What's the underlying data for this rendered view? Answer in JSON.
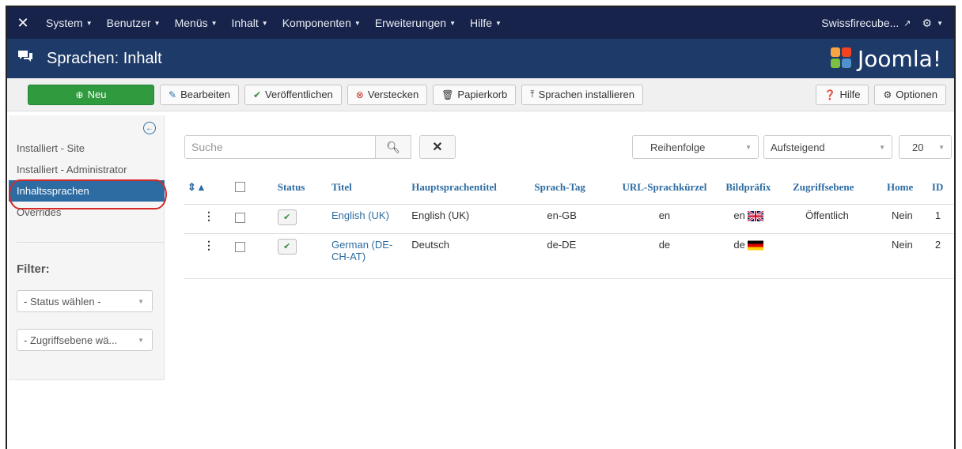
{
  "topbar": {
    "logo_icon": "joomla-x-icon",
    "menus": [
      "System",
      "Benutzer",
      "Menüs",
      "Inhalt",
      "Komponenten",
      "Erweiterungen",
      "Hilfe"
    ],
    "site_link": "Swissfirecube...",
    "settings_icon": "gear-icon"
  },
  "header": {
    "title": "Sprachen: Inhalt",
    "brand": "Joomla!"
  },
  "toolbar": {
    "new": "Neu",
    "edit": "Bearbeiten",
    "publish": "Veröffentlichen",
    "unpublish": "Verstecken",
    "trash": "Papierkorb",
    "install": "Sprachen installieren",
    "help": "Hilfe",
    "options": "Optionen"
  },
  "sidebar": {
    "items": [
      "Installiert - Site",
      "Installiert - Administrator",
      "Inhaltssprachen",
      "Overrides"
    ],
    "active_index": 2,
    "filter_label": "Filter:",
    "status_select": "- Status wählen -",
    "access_select": "- Zugriffsebene wä..."
  },
  "search": {
    "placeholder": "Suche",
    "ordering": "Reihenfolge",
    "direction": "Aufsteigend",
    "limit": "20"
  },
  "table": {
    "headers": {
      "status": "Status",
      "title": "Titel",
      "native": "Hauptsprachentitel",
      "tag": "Sprach-Tag",
      "sef": "URL-Sprachkürzel",
      "image": "Bildpräfix",
      "access": "Zugriffsebene",
      "home": "Home",
      "id": "ID"
    },
    "rows": [
      {
        "title": "English (UK)",
        "native": "English (UK)",
        "tag": "en-GB",
        "sef": "en",
        "image": "en",
        "access": "Öffentlich",
        "home": "Nein",
        "id": "1"
      },
      {
        "title": "German (DE-CH-AT)",
        "native": "Deutsch",
        "tag": "de-DE",
        "sef": "de",
        "image": "de",
        "access": "",
        "home": "Nein",
        "id": "2"
      }
    ]
  },
  "colors": {
    "topbar": "#17234a",
    "header": "#1e3a68",
    "accent": "#2d6ca2",
    "new_button": "#2f9a3e",
    "highlight": "#d32a2a"
  }
}
